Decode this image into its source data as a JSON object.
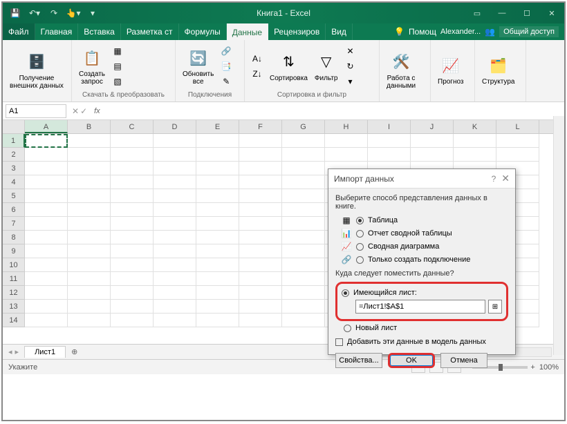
{
  "window": {
    "title": "Книга1 - Excel"
  },
  "tabs": {
    "file": "Файл",
    "items": [
      "Главная",
      "Вставка",
      "Разметка ст",
      "Формулы",
      "Данные",
      "Рецензиров",
      "Вид"
    ],
    "active": "Данные",
    "help": "Помощ",
    "user": "Alexander...",
    "share": "Общий доступ"
  },
  "ribbon": {
    "g1": {
      "btn": "Получение\nвнешних данных",
      "label": ""
    },
    "g2": {
      "btn": "Создать\nзапрос",
      "label": "Скачать & преобразовать"
    },
    "g3": {
      "btn": "Обновить\nвсе",
      "label": "Подключения"
    },
    "g4": {
      "sort": "Сортировка",
      "filter": "Фильтр",
      "label": "Сортировка и фильтр"
    },
    "g5": {
      "btn": "Работа с\nданными"
    },
    "g6": {
      "btn": "Прогноз"
    },
    "g7": {
      "btn": "Структура"
    }
  },
  "namebox": "A1",
  "columns": [
    "A",
    "B",
    "C",
    "D",
    "E",
    "F",
    "G",
    "H",
    "I",
    "J",
    "K",
    "L"
  ],
  "rows": [
    "1",
    "2",
    "3",
    "4",
    "5",
    "6",
    "7",
    "8",
    "9",
    "10",
    "11",
    "12",
    "13",
    "14"
  ],
  "sheet": {
    "tab": "Лист1"
  },
  "status": {
    "left": "Укажите",
    "zoom": "100%"
  },
  "dialog": {
    "title": "Импорт данных",
    "prompt": "Выберите способ представления данных в книге.",
    "opts": {
      "table": "Таблица",
      "pivot": "Отчет сводной таблицы",
      "chart": "Сводная диаграмма",
      "conn": "Только создать подключение"
    },
    "where": "Куда следует поместить данные?",
    "existing": "Имеющийся лист:",
    "ref": "=Лист1!$A$1",
    "newsheet": "Новый лист",
    "model": "Добавить эти данные в модель данных",
    "props": "Свойства...",
    "ok": "OK",
    "cancel": "Отмена"
  }
}
